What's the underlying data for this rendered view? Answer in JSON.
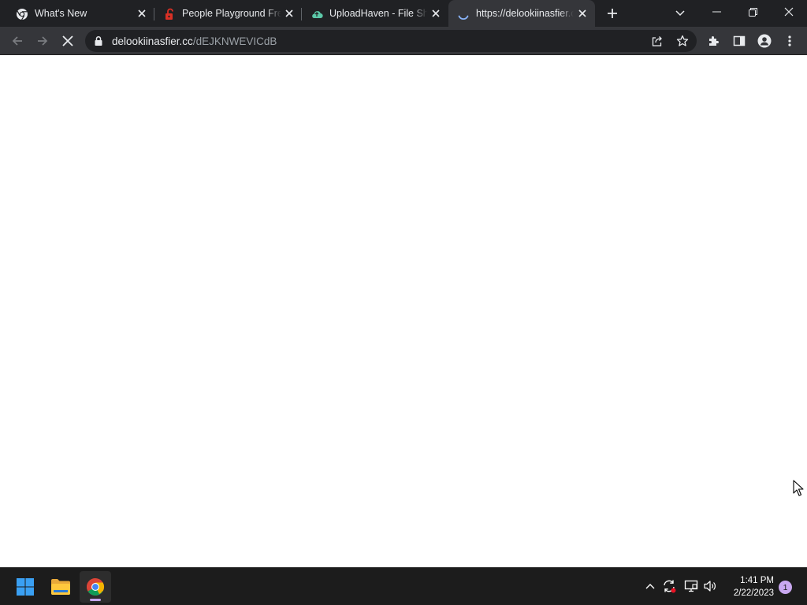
{
  "browser": {
    "tabs": [
      {
        "title": "What's New",
        "icon": "chrome-icon",
        "active": false
      },
      {
        "title": "People Playground Free",
        "icon": "red-lock-icon",
        "active": false
      },
      {
        "title": "UploadHaven - File Sharing",
        "icon": "cloud-icon",
        "active": false
      },
      {
        "title": "https://delookiinasfier.cc",
        "icon": "loading-spinner-icon",
        "active": true
      }
    ],
    "url_host": "delookiinasfier.cc",
    "url_path": "/dEJKNWEVICdB"
  },
  "taskbar": {
    "apps": [
      {
        "name": "Start",
        "icon": "windows-logo-icon"
      },
      {
        "name": "File Explorer",
        "icon": "folder-icon"
      },
      {
        "name": "Google Chrome",
        "icon": "chrome-icon",
        "active": true
      }
    ],
    "time": "1:41 PM",
    "date": "2/22/2023",
    "notification_count": "1"
  },
  "colors": {
    "tabstrip_bg": "#202124",
    "toolbar_bg": "#35363a",
    "omnibox_bg": "#202124",
    "taskbar_bg": "#1c1c1c",
    "accent": "#c6a7ee"
  }
}
